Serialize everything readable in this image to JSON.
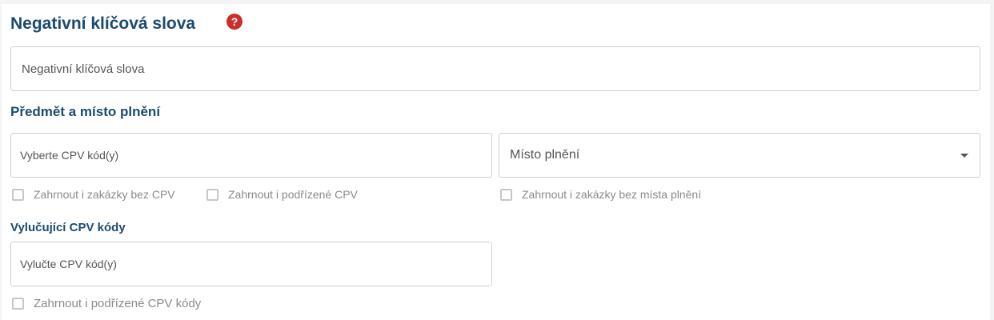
{
  "negative_keywords": {
    "heading": "Negativní klíčová slova",
    "help_icon": "question-circle-icon",
    "input_placeholder": "Negativní klíčová slova",
    "input_value": ""
  },
  "subject_place": {
    "heading": "Předmět a místo plnění",
    "cpv_input_placeholder": "Vyberte CPV kód(y)",
    "cpv_input_value": "",
    "place_select_label": "Místo plnění",
    "place_select_icon": "chevron-down-icon",
    "checkboxes": [
      {
        "label": "Zahrnout i zakázky bez CPV",
        "checked": false
      },
      {
        "label": "Zahrnout i podřízené CPV",
        "checked": false
      },
      {
        "label": "Zahrnout i zakázky bez místa plnění",
        "checked": false
      }
    ]
  },
  "excluded_cpv": {
    "heading": "Vylučující CPV kódy",
    "input_placeholder": "Vylučte CPV kód(y)",
    "input_value": "",
    "checkbox": {
      "label": "Zahrnout i podřízené CPV kódy",
      "checked": false
    }
  },
  "colors": {
    "heading": "#1c4a70",
    "help_icon": "#c8302c",
    "border": "#cfcfcf",
    "muted_text": "#8a8a8a"
  }
}
